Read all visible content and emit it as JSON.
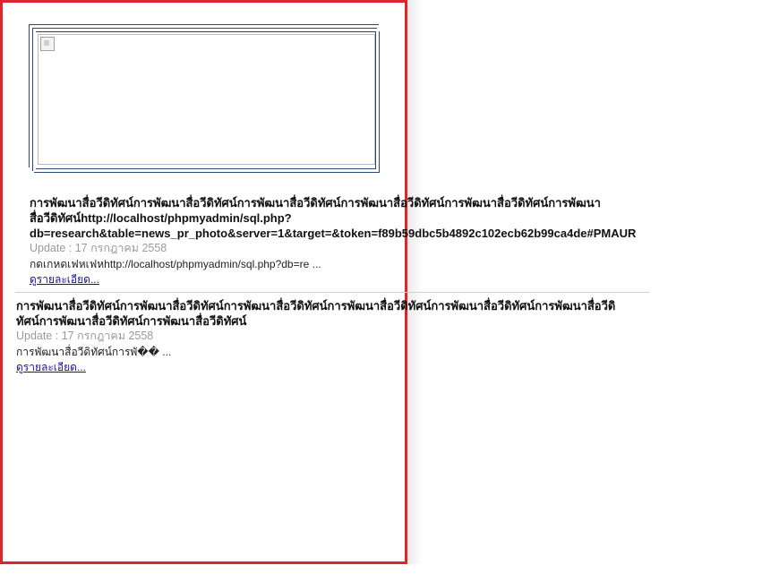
{
  "items": [
    {
      "title": "การพัฒนาสื่อวีดิทัศน์การพัฒนาสื่อวีดิทัศน์การพัฒนาสื่อวีดิทัศน์การพัฒนาสื่อวีดิทัศน์การพัฒนาสื่อวีดิทัศน์การพัฒนาสื่อวีดิทัศน์http://localhost/phpmyadmin/sql.php?db=research&table=news_pr_photo&server=1&target=&token=f89b59dbc5b4892c102ecb62b99ca4de#PMAUR",
      "title_line1": "การพัฒนาสื่อวีดิทัศน์การพัฒนาสื่อวีดิทัศน์การพัฒนาสื่อวีดิทัศน์การพัฒนาสื่อวีดิทัศน์การพัฒนาสื่อวีดิทัศน์การพัฒนา",
      "title_line2": "สื่อวีดิทัศน์http://localhost/phpmyadmin/sql.php?",
      "title_line3": "db=research&table=news_pr_photo&server=1&target=&token=f89b59dbc5b4892c102ecb62b99ca4de#PMAUR",
      "date": "Update : 17 กรกฎาคม 2558",
      "excerpt": "กดเกหดเฟหเฟหhttp://localhost/phpmyadmin/sql.php?db=re ...",
      "more": "ดูรายละเอียด..."
    },
    {
      "title_line1": "การพัฒนาสื่อวีดิทัศน์การพัฒนาสื่อวีดิทัศน์การพัฒนาสื่อวีดิทัศน์การพัฒนาสื่อวีดิทัศน์การพัฒนาสื่อวีดิทัศน์การพัฒนาสื่อวีดิ",
      "title_line2": "ทัศน์การพัฒนาสื่อวีดิทัศน์การพัฒนาสื่อวีดิทัศน์",
      "date": "Update : 17 กรกฎาคม 2558",
      "excerpt": "การพัฒนาสื่อวีดิทัศน์การพั�� ...",
      "more": "ดูรายละเอียด..."
    }
  ],
  "colors": {
    "frame_border": "#e0242b",
    "image_frame": "#2b4a73",
    "link": "#1a0dab",
    "date": "#9a9a9a"
  }
}
